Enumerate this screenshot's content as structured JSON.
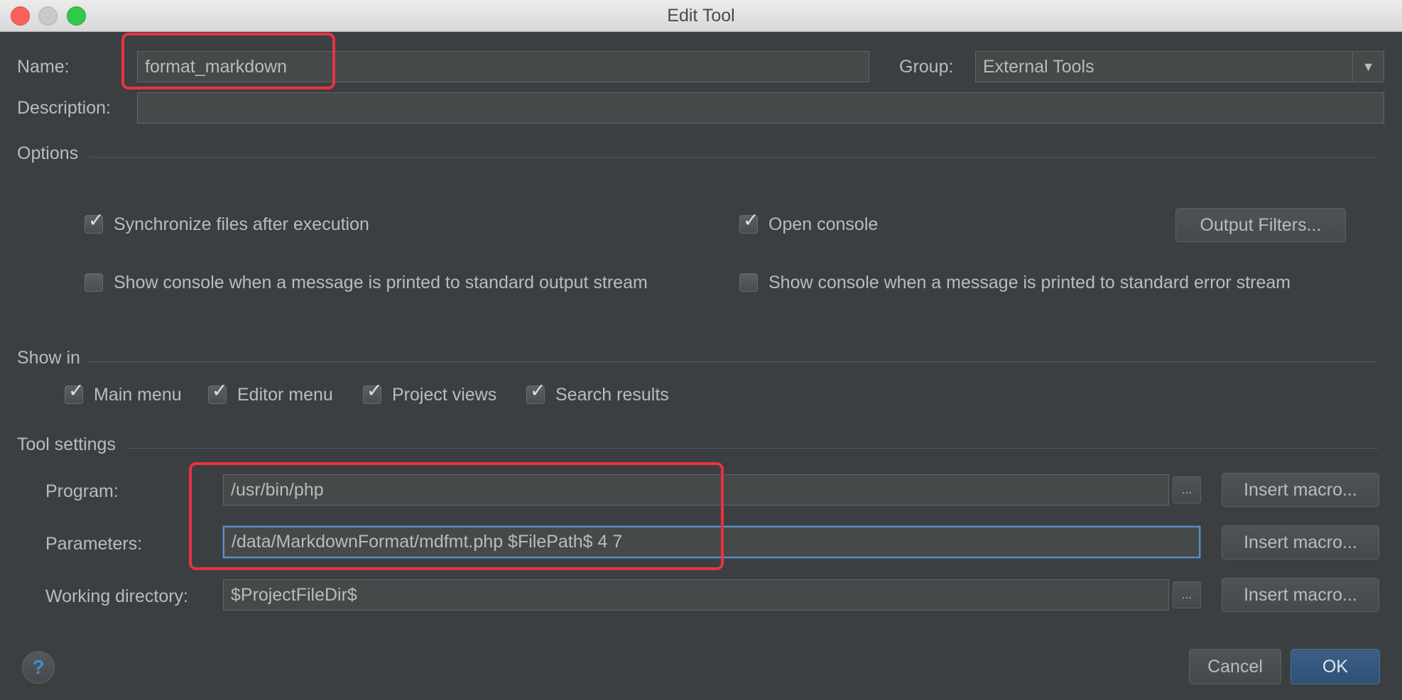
{
  "window": {
    "title": "Edit Tool"
  },
  "fields": {
    "name_label": "Name:",
    "name_value": "format_markdown",
    "group_label": "Group:",
    "group_value": "External Tools",
    "description_label": "Description:",
    "description_value": ""
  },
  "options": {
    "section_title": "Options",
    "sync_files": {
      "label": "Synchronize files after execution",
      "checked": true
    },
    "open_console": {
      "label": "Open console",
      "checked": true
    },
    "output_filters_button": "Output Filters...",
    "console_stdout": {
      "label": "Show console when a message is printed to standard output stream",
      "checked": false
    },
    "console_stderr": {
      "label": "Show console when a message is printed to standard error stream",
      "checked": false
    }
  },
  "show_in": {
    "section_title": "Show in",
    "main_menu": {
      "label": "Main menu",
      "checked": true
    },
    "editor_menu": {
      "label": "Editor menu",
      "checked": true
    },
    "project_views": {
      "label": "Project views",
      "checked": true
    },
    "search_results": {
      "label": "Search results",
      "checked": true
    }
  },
  "tool_settings": {
    "section_title": "Tool settings",
    "program_label": "Program:",
    "program_value": "/usr/bin/php",
    "parameters_label": "Parameters:",
    "parameters_value": "/data/MarkdownFormat/mdfmt.php $FilePath$ 4 7",
    "working_dir_label": "Working directory:",
    "working_dir_value": "$ProjectFileDir$",
    "browse_label": "...",
    "insert_macro_label": "Insert macro..."
  },
  "footer": {
    "help": "?",
    "cancel": "Cancel",
    "ok": "OK"
  },
  "colors": {
    "accent": "#2f5176",
    "annotation": "#e8323f",
    "background": "#3c3f41"
  }
}
